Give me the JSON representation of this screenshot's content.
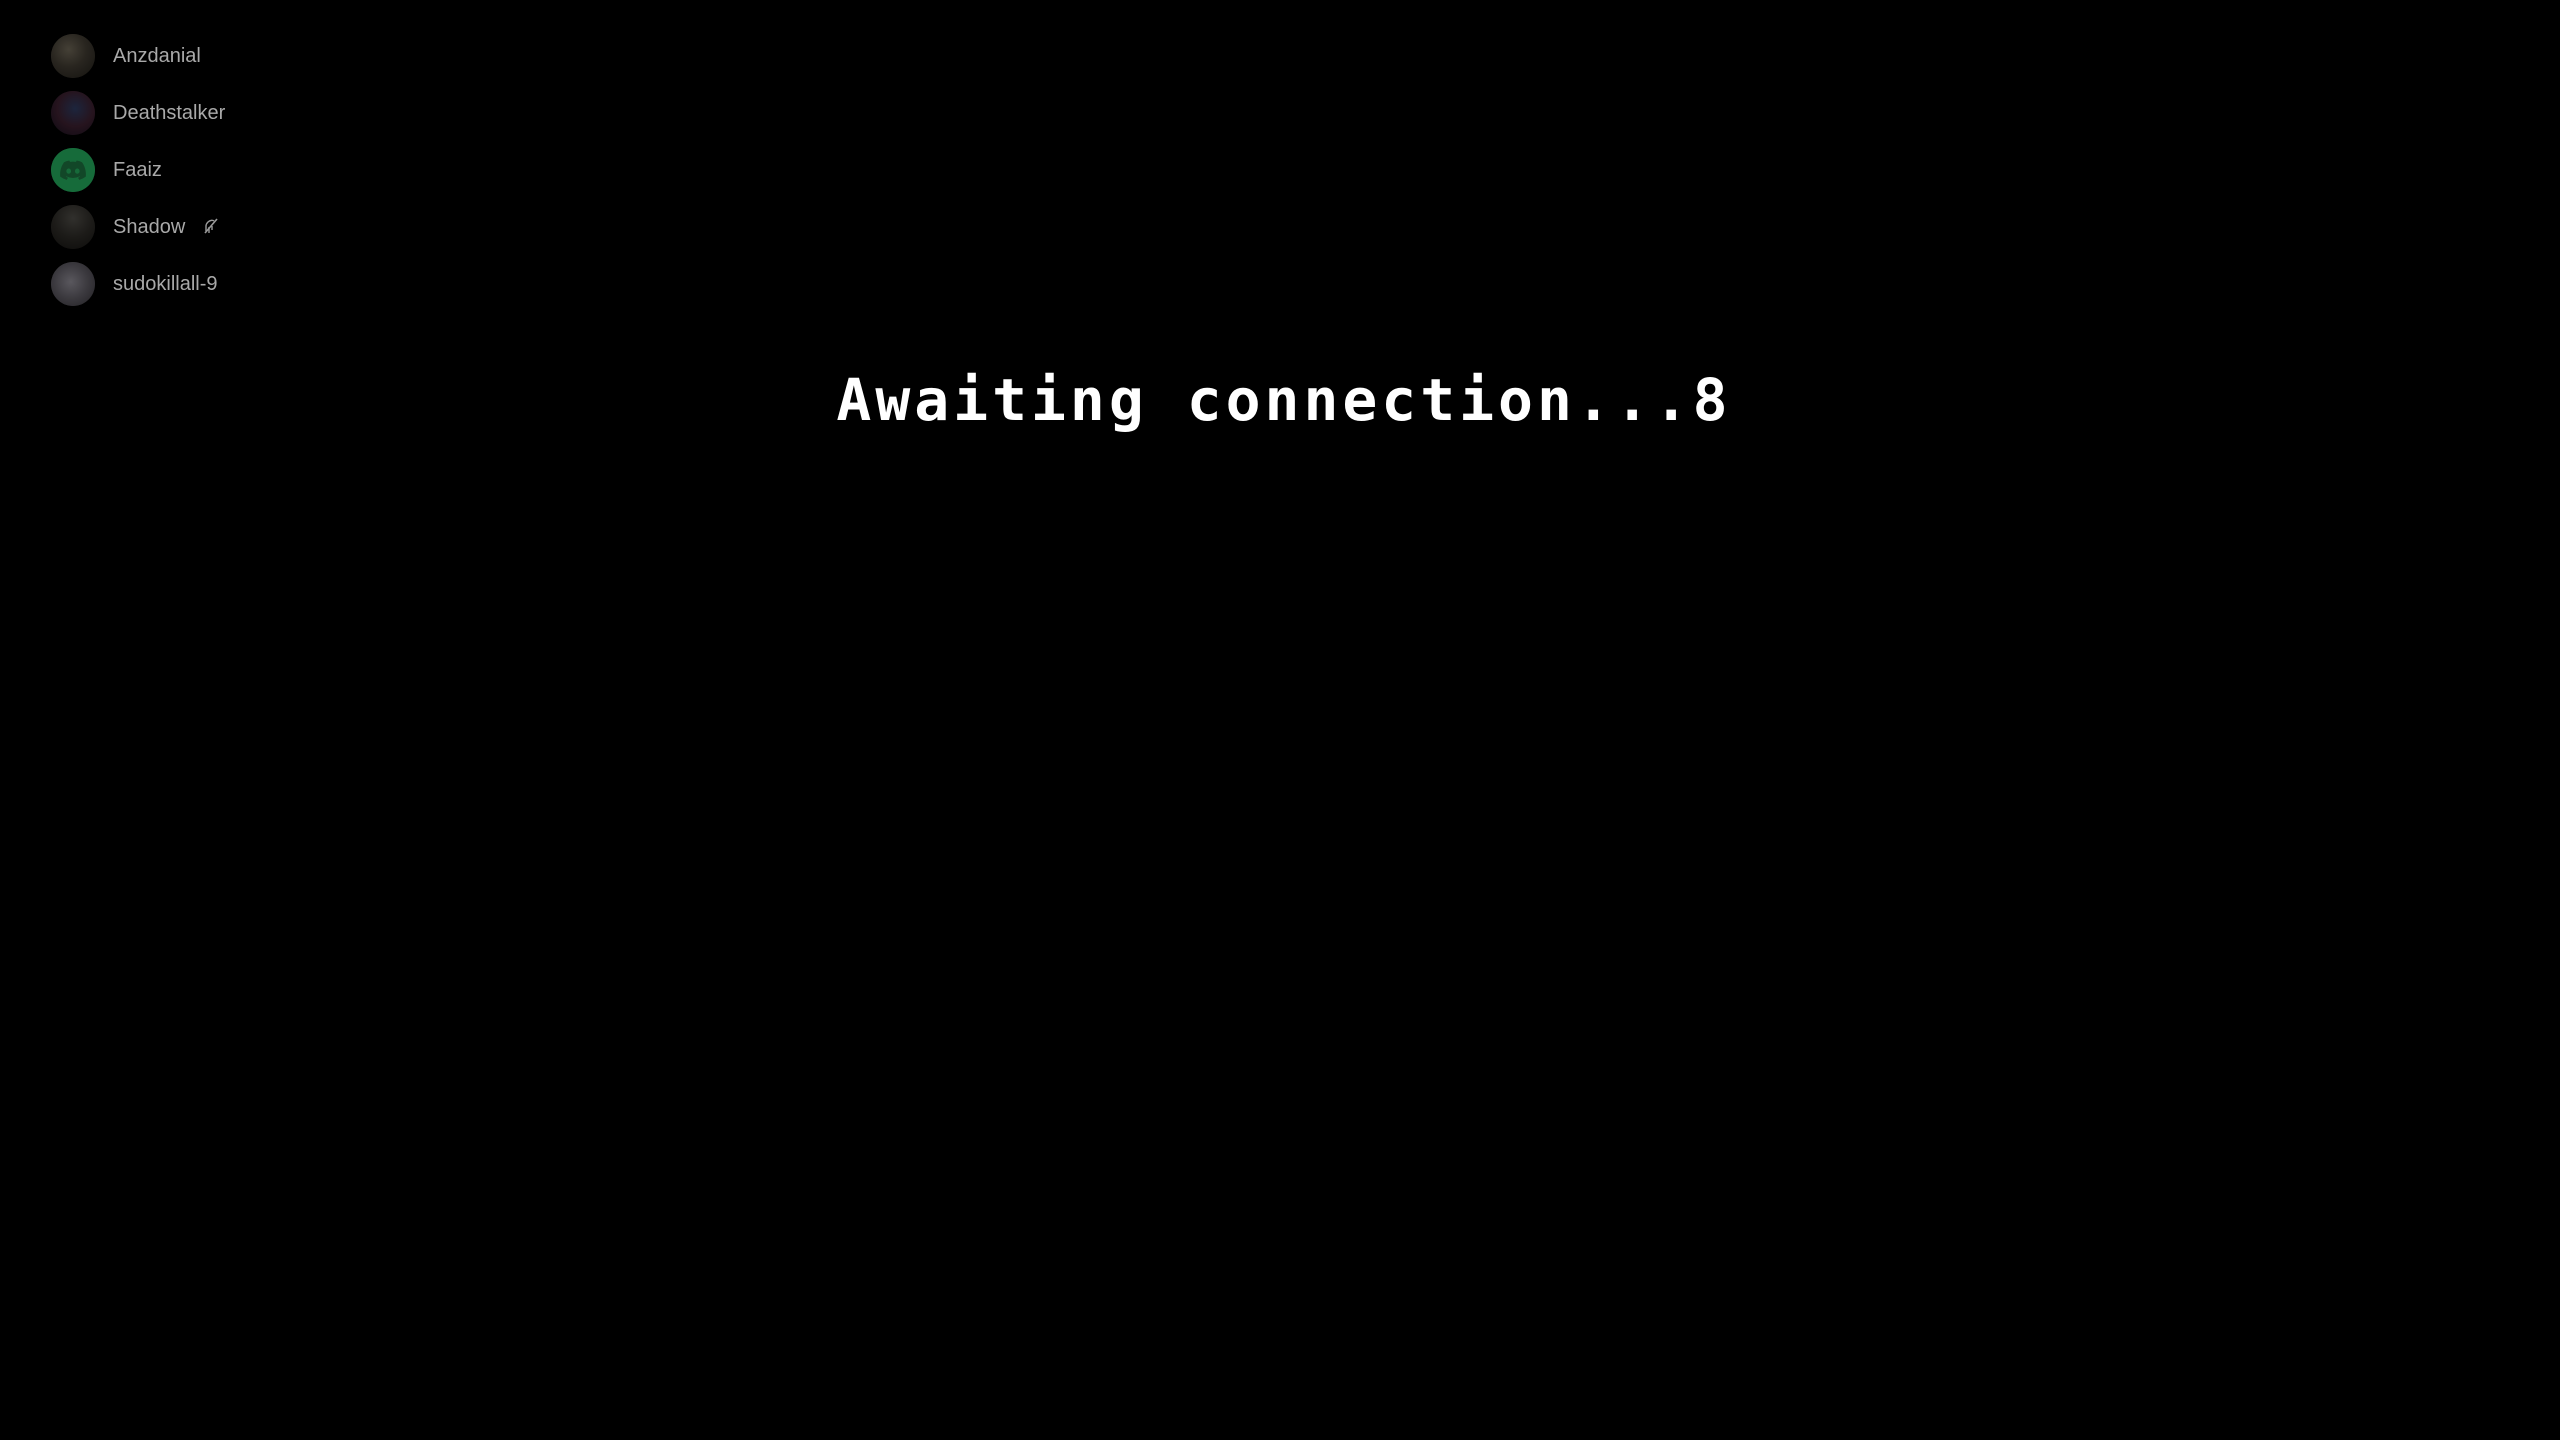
{
  "members": [
    {
      "name": "Anzdanial",
      "avatar": "photo-avatar"
    },
    {
      "name": "Deathstalker",
      "avatar": "photo-avatar"
    },
    {
      "name": "Faaiz",
      "avatar": "discord-logo-icon"
    },
    {
      "name": "Shadow",
      "avatar": "photo-avatar",
      "status_icon": "deafened-icon"
    },
    {
      "name": "sudokillall-9",
      "avatar": "photo-avatar"
    }
  ],
  "status": {
    "message": "Awaiting connection...8"
  },
  "colors": {
    "background": "#000000",
    "member_text": "#a9a9a9",
    "status_text": "#ffffff",
    "discord_green": "#23a559"
  }
}
